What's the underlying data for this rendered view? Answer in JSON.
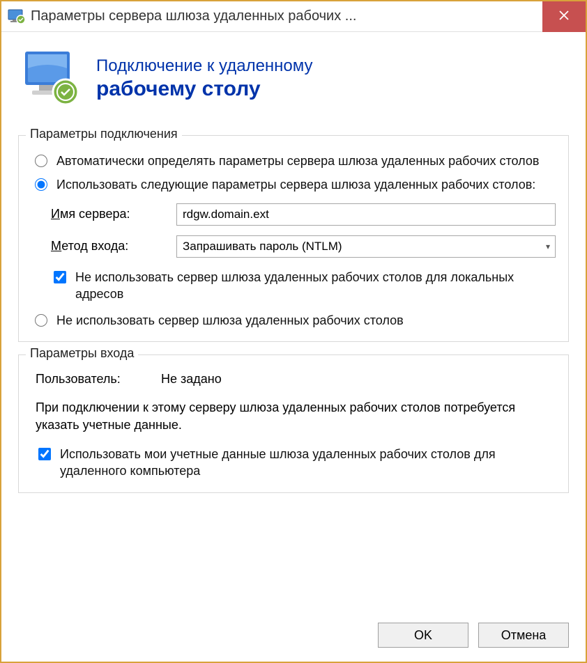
{
  "window": {
    "title": "Параметры сервера шлюза удаленных рабочих ..."
  },
  "header": {
    "line1": "Подключение к удаленному",
    "line2": "рабочему столу"
  },
  "connection_group": {
    "legend": "Параметры подключения",
    "radio_auto": "Автоматически определять параметры сервера шлюза удаленных рабочих столов",
    "radio_manual": "Использовать следующие параметры сервера шлюза удаленных рабочих столов:",
    "server_label": "Имя сервера:",
    "server_value": "rdgw.domain.ext",
    "method_label": "Метод входа:",
    "method_value": "Запрашивать пароль (NTLM)",
    "bypass_local": "Не использовать сервер шлюза удаленных рабочих столов для локальных адресов",
    "radio_none": "Не использовать сервер шлюза удаленных рабочих столов"
  },
  "login_group": {
    "legend": "Параметры входа",
    "user_label": "Пользователь:",
    "user_value": "Не задано",
    "note": "При подключении к этому серверу шлюза удаленных рабочих столов потребуется указать учетные данные.",
    "share_creds": "Использовать мои учетные данные шлюза удаленных рабочих столов для удаленного компьютера"
  },
  "buttons": {
    "ok": "OK",
    "cancel": "Отмена"
  },
  "state": {
    "radio_selected": "manual",
    "bypass_checked": true,
    "share_checked": true
  }
}
